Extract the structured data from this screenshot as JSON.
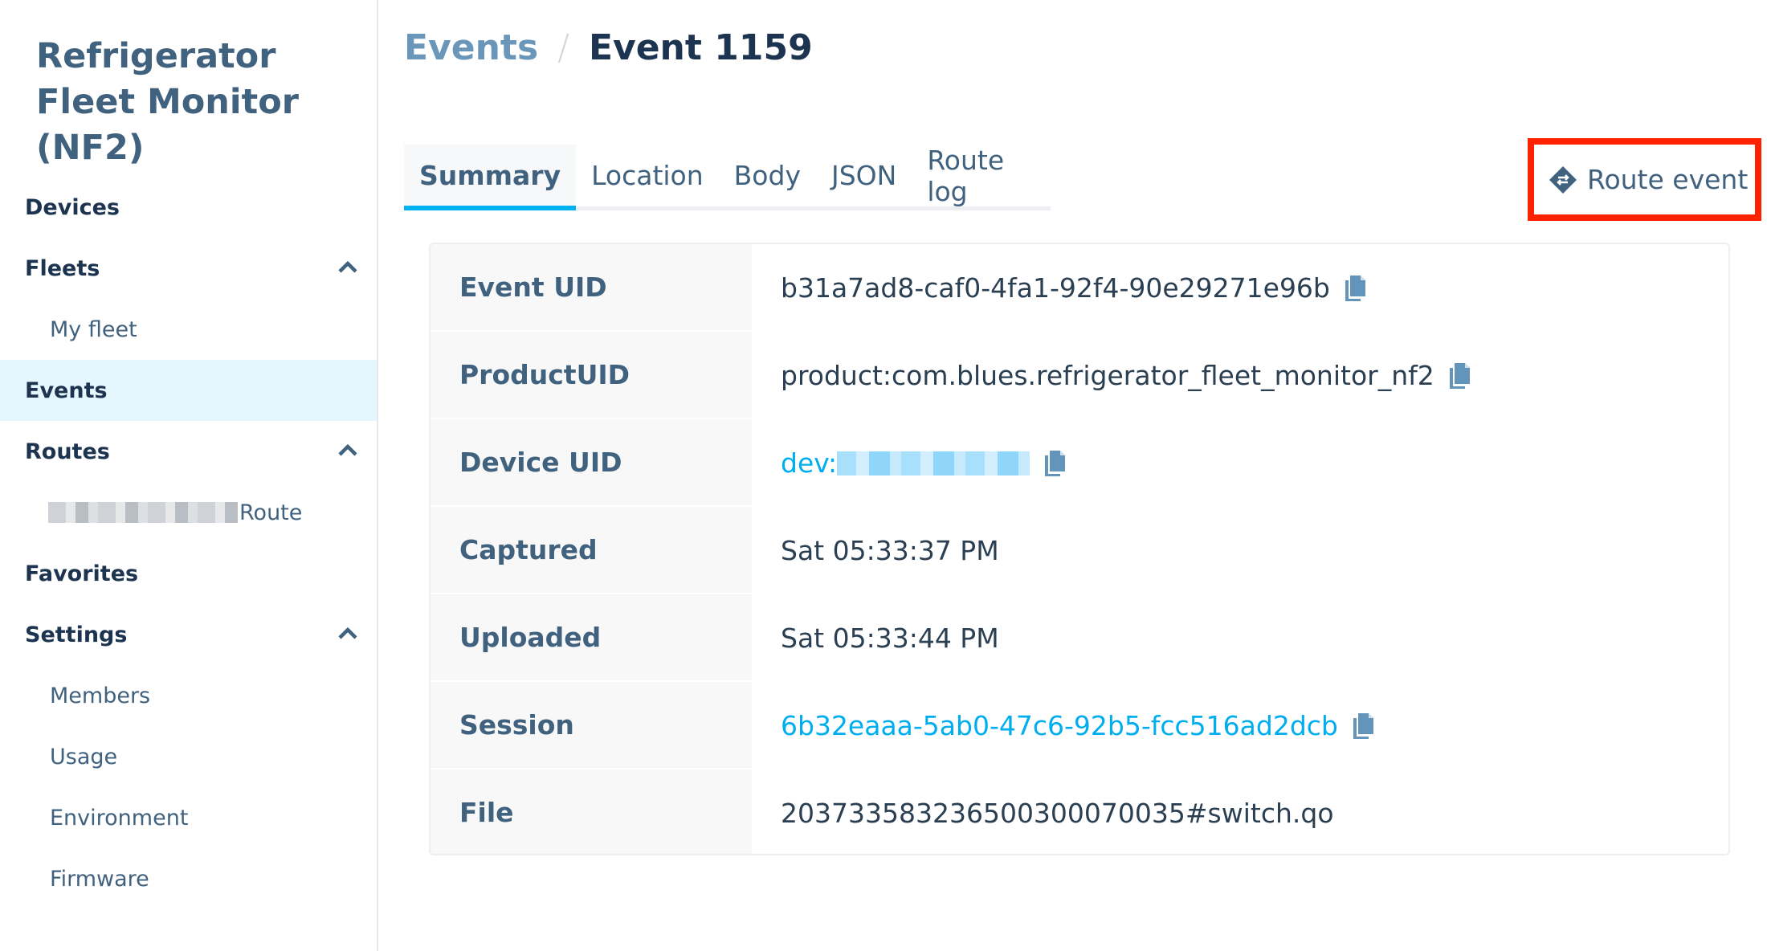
{
  "sidebar": {
    "app_title": "Refrigerator Fleet Monitor (NF2)",
    "items": [
      {
        "label": "Devices"
      },
      {
        "label": "Fleets",
        "expanded": true
      },
      {
        "label": "My fleet"
      },
      {
        "label": "Events",
        "active": true
      },
      {
        "label": "Routes",
        "expanded": true
      },
      {
        "label": "Route"
      },
      {
        "label": "Favorites"
      },
      {
        "label": "Settings",
        "expanded": true
      },
      {
        "label": "Members"
      },
      {
        "label": "Usage"
      },
      {
        "label": "Environment"
      },
      {
        "label": "Firmware"
      }
    ]
  },
  "breadcrumb": {
    "parent": "Events",
    "separator": "/",
    "current": "Event 1159"
  },
  "tabs": [
    "Summary",
    "Location",
    "Body",
    "JSON",
    "Route log"
  ],
  "route_button": "Route event",
  "details": [
    {
      "label": "Event UID",
      "value": "b31a7ad8-caf0-4fa1-92f4-90e29271e96b"
    },
    {
      "label": "ProductUID",
      "value": "product:com.blues.refrigerator_fleet_monitor_nf2"
    },
    {
      "label": "Device UID",
      "value": "dev:"
    },
    {
      "label": "Captured",
      "value": "Sat 05:33:37 PM"
    },
    {
      "label": "Uploaded",
      "value": "Sat 05:33:44 PM"
    },
    {
      "label": "Session",
      "value": "6b32eaaa-5ab0-47c6-92b5-fcc516ad2dcb"
    },
    {
      "label": "File",
      "value": "20373358323650030007003​5#switch.qo"
    }
  ],
  "colors": {
    "accent": "#00b0f0",
    "highlight": "#ff2200",
    "active_nav": "#e6f6fd"
  }
}
